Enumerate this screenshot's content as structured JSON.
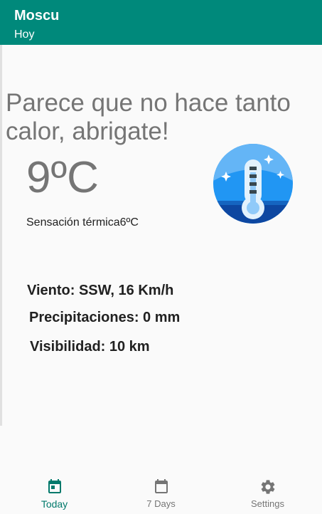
{
  "header": {
    "title": "Moscu",
    "subtitle": "Hoy"
  },
  "main": {
    "message": "Parece que no hace tanto calor, abrigate!",
    "temperature": "9ºC",
    "feels_like": "Sensación térmica6ºC",
    "weather_icon": "thermometer-icon",
    "details": {
      "wind": "Viento: SSW, 16 Km/h",
      "precipitation": "Precipitaciones: 0 mm",
      "visibility": "Visibilidad: 10 km"
    }
  },
  "bottom_nav": {
    "items": [
      {
        "label": "Today",
        "icon": "calendar-today-icon",
        "active": true
      },
      {
        "label": "7 Days",
        "icon": "calendar-icon",
        "active": false
      },
      {
        "label": "Settings",
        "icon": "gear-icon",
        "active": false
      }
    ]
  },
  "colors": {
    "primary": "#00897b",
    "active_nav": "#00796b",
    "inactive_nav": "#757575",
    "text_secondary": "#757575",
    "icon_blue": "#1e88e5"
  }
}
